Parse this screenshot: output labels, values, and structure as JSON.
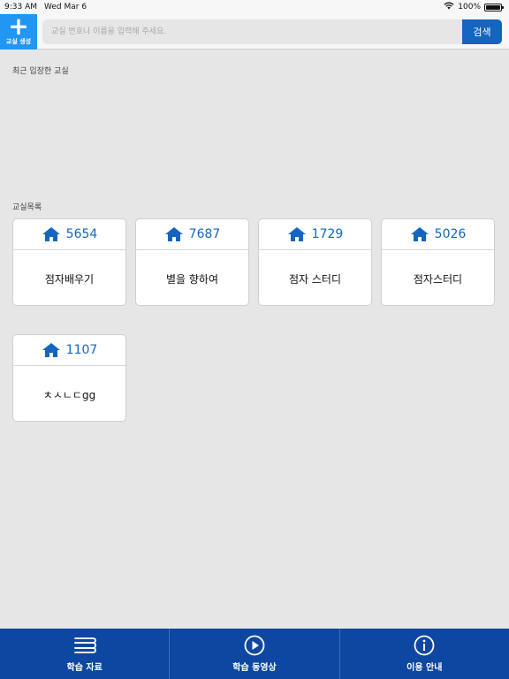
{
  "status_bar": {
    "time": "9:33 AM",
    "date": "Wed Mar 6",
    "battery": "100%",
    "battery_level": 1.0
  },
  "topbar": {
    "create_label": "교실 생성",
    "search_placeholder": "교실 번호나 이름을 입력해 주세요.",
    "search_button": "검색"
  },
  "recent": {
    "title": "최근 입장한 교실"
  },
  "classrooms": {
    "title": "교실목록",
    "items": [
      {
        "number": "5654",
        "name": "점자배우기"
      },
      {
        "number": "7687",
        "name": "별을 향하여"
      },
      {
        "number": "1729",
        "name": "점자 스터디"
      },
      {
        "number": "5026",
        "name": "점자스터디"
      },
      {
        "number": "1107",
        "name": "ㅊㅅㄴㄷgg"
      }
    ]
  },
  "bottom_tabs": [
    {
      "label": "학습 자료",
      "icon": "book-stack-icon"
    },
    {
      "label": "학습 동영상",
      "icon": "play-circle-icon"
    },
    {
      "label": "이용 안내",
      "icon": "info-circle-icon"
    }
  ],
  "colors": {
    "accent": "#2196f3",
    "primary": "#1565c0",
    "bottom_bar": "#0d47a1",
    "background": "#e6e6e6"
  }
}
